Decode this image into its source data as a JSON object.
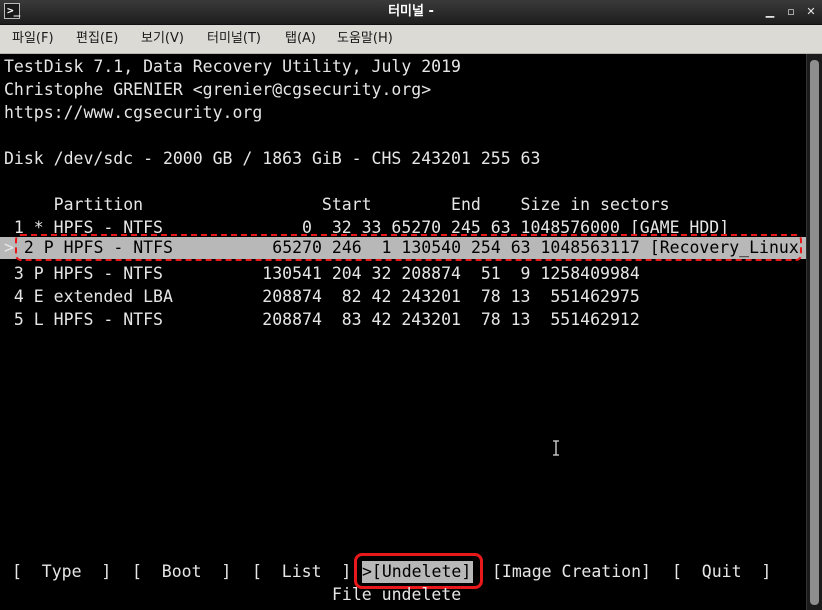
{
  "window": {
    "title": "터미널 -",
    "app_icon_glyph": ">_",
    "controls": {
      "minimize": "▁",
      "maximize": "▫",
      "close": "✕"
    }
  },
  "menu": {
    "file": "파일(F)",
    "edit": "편집(E)",
    "view": "보기(V)",
    "terminal": "터미널(T)",
    "tabs": "탭(A)",
    "help": "도움말(H)"
  },
  "terminal": {
    "header_line1": "TestDisk 7.1, Data Recovery Utility, July 2019",
    "header_line2": "Christophe GRENIER <grenier@cgsecurity.org>",
    "header_line3": "https://www.cgsecurity.org",
    "disk_line": "Disk /dev/sdc - 2000 GB / 1863 GiB - CHS 243201 255 63",
    "column_header": "     Partition                  Start        End    Size in sectors",
    "selected_marker": ">",
    "partitions": [
      " 1 * HPFS - NTFS              0  32 33 65270 245 63 1048576000 [GAME HDD]",
      " 2 P HPFS - NTFS          65270 246  1 130540 254 63 1048563117 [Recovery_Linux",
      " 3 P HPFS - NTFS          130541 204 32 208874  51  9 1258409984",
      " 4 E extended LBA         208874  82 42 243201  78 13  551462975",
      " 5 L HPFS - NTFS          208874  83 42 243201  78 13  551462912"
    ],
    "actions": {
      "type": "[  Type  ]",
      "boot": "[  Boot  ]",
      "list": "[  List  ]",
      "undelete": ">[Undelete]",
      "image_creation": "[Image Creation]",
      "quit": "[  Quit  ]"
    },
    "action_hint": "File undelete"
  },
  "colors": {
    "terminal_bg": "#000000",
    "terminal_fg": "#e6e6e6",
    "selection_bg": "#b8b8b8",
    "annotation_red": "#e8181b",
    "menubar_bg": "#dcdad5",
    "titlebar_bg": "#2a2a2a"
  },
  "icons": [
    "terminal-app-icon",
    "minimize-icon",
    "maximize-icon",
    "close-icon",
    "text-cursor-icon"
  ]
}
